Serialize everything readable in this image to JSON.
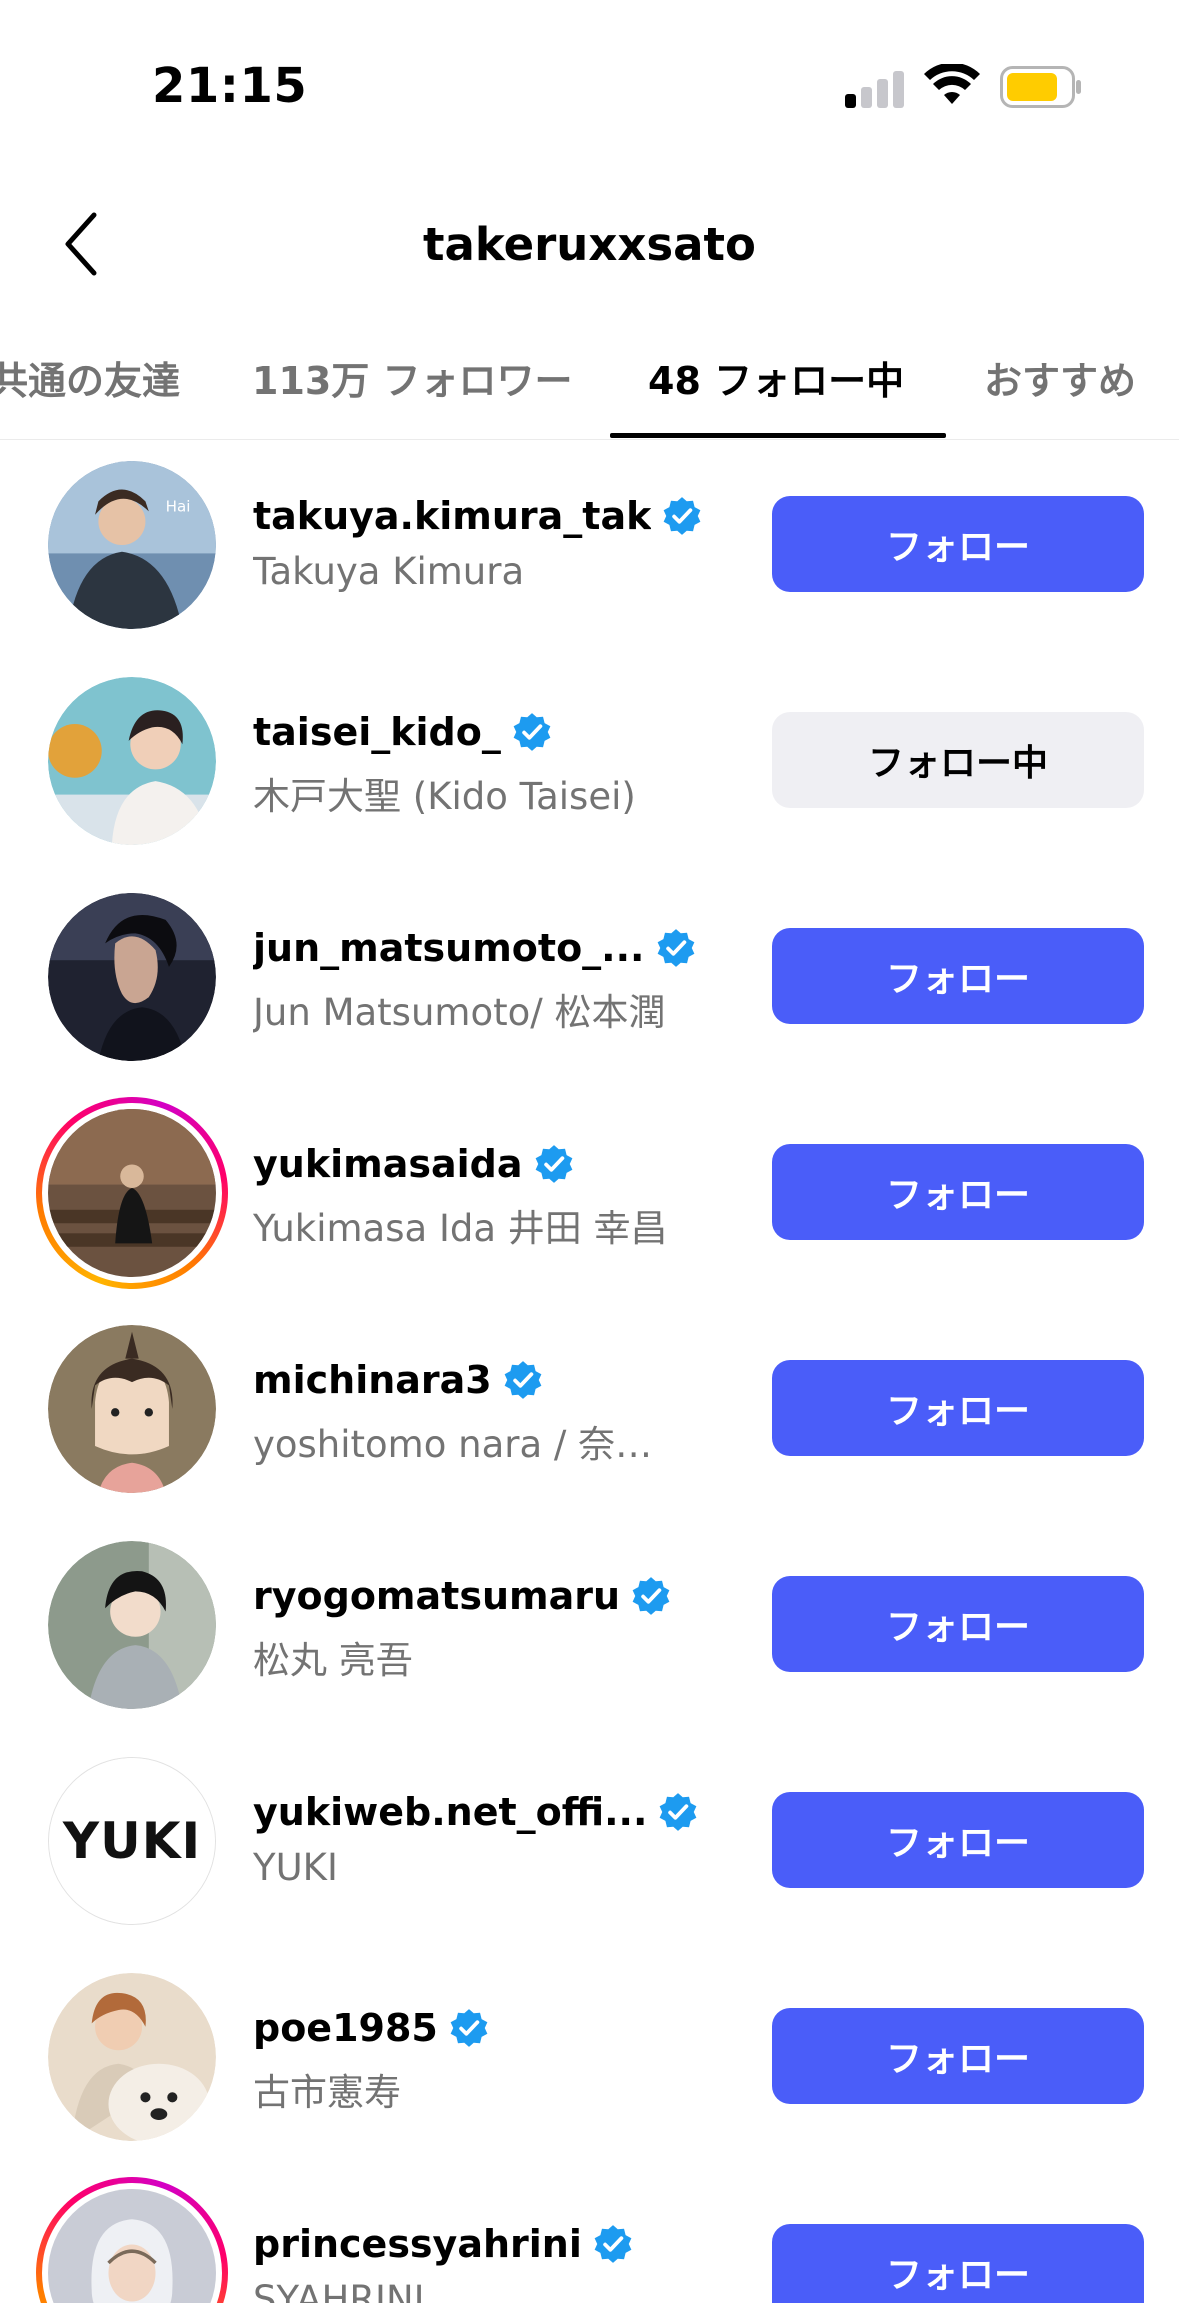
{
  "status_bar": {
    "time": "21:15"
  },
  "header": {
    "title": "takeruxxsato"
  },
  "tabs": [
    {
      "label": "共通の友達"
    },
    {
      "label": "113万 フォロワー"
    },
    {
      "label": "48 フォロー中"
    },
    {
      "label": "おすすめ"
    }
  ],
  "colors": {
    "follow_button": "#4a5df9",
    "following_button": "#efeff3",
    "verified_badge": "#1d9bf0",
    "secondary_text": "#737373"
  },
  "users": [
    {
      "username": "takuya.kimura_tak",
      "name": "Takuya Kimura",
      "button": "フォロー"
    },
    {
      "username": "taisei_kido_",
      "name": "木戸大聖 (Kido Taisei)",
      "button": "フォロー中"
    },
    {
      "username": "jun_matsumoto_...",
      "name": "Jun Matsumoto/ 松本潤",
      "button": "フォロー"
    },
    {
      "username": "yukimasaida",
      "name": "Yukimasa Ida 井田 幸昌",
      "button": "フォロー"
    },
    {
      "username": "michinara3",
      "name": "yoshitomo nara / 奈…",
      "button": "フォロー"
    },
    {
      "username": "ryogomatsumaru",
      "name": "松丸 亮吾",
      "button": "フォロー"
    },
    {
      "username": "yukiweb.net_offi...",
      "name": "YUKI",
      "button": "フォロー",
      "avatar_text": "YUKI"
    },
    {
      "username": "poe1985",
      "name": "古市憲寿",
      "button": "フォロー"
    },
    {
      "username": "princessyahrini",
      "name": "SYAHRINI",
      "button": "フォロー"
    }
  ]
}
